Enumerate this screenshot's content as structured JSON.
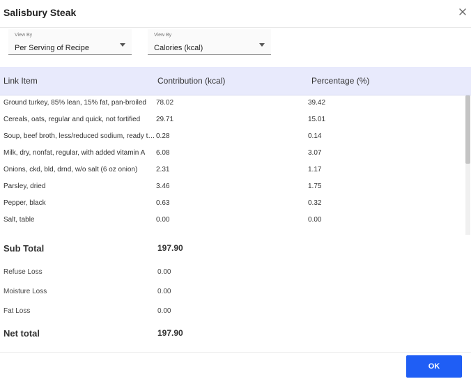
{
  "dialog": {
    "title": "Salisbury Steak",
    "close_icon": "close-icon"
  },
  "filters": [
    {
      "label": "View By",
      "value": "Per Serving of Recipe"
    },
    {
      "label": "View By",
      "value": "Calories (kcal)"
    }
  ],
  "table": {
    "headers": [
      "Link Item",
      "Contribution (kcal)",
      "Percentage (%)"
    ],
    "rows": [
      {
        "item": "Ground turkey, 85% lean, 15% fat, pan-broiled",
        "contribution": "78.02",
        "percentage": "39.42"
      },
      {
        "item": "Cereals, oats, regular and quick, not fortified",
        "contribution": "29.71",
        "percentage": "15.01"
      },
      {
        "item": "Soup, beef broth, less/reduced sodium, ready to serve",
        "contribution": "0.28",
        "percentage": "0.14"
      },
      {
        "item": "Milk, dry, nonfat, regular, with added vitamin A",
        "contribution": "6.08",
        "percentage": "3.07"
      },
      {
        "item": "Onions, ckd, bld, drnd, w/o salt (6 oz onion)",
        "contribution": "2.31",
        "percentage": "1.17"
      },
      {
        "item": "Parsley, dried",
        "contribution": "3.46",
        "percentage": "1.75"
      },
      {
        "item": "Pepper, black",
        "contribution": "0.63",
        "percentage": "0.32"
      },
      {
        "item": "Salt, table",
        "contribution": "0.00",
        "percentage": "0.00"
      }
    ]
  },
  "summary": {
    "sub_total_label": "Sub Total",
    "sub_total_value": "197.90",
    "refuse_loss_label": "Refuse Loss",
    "refuse_loss_value": "0.00",
    "moisture_loss_label": "Moisture Loss",
    "moisture_loss_value": "0.00",
    "fat_loss_label": "Fat Loss",
    "fat_loss_value": "0.00",
    "net_total_label": "Net total",
    "net_total_value": "197.90"
  },
  "footer": {
    "ok_label": "OK"
  },
  "colors": {
    "accent": "#1f5ef5",
    "header_bg": "#e8eafc"
  }
}
